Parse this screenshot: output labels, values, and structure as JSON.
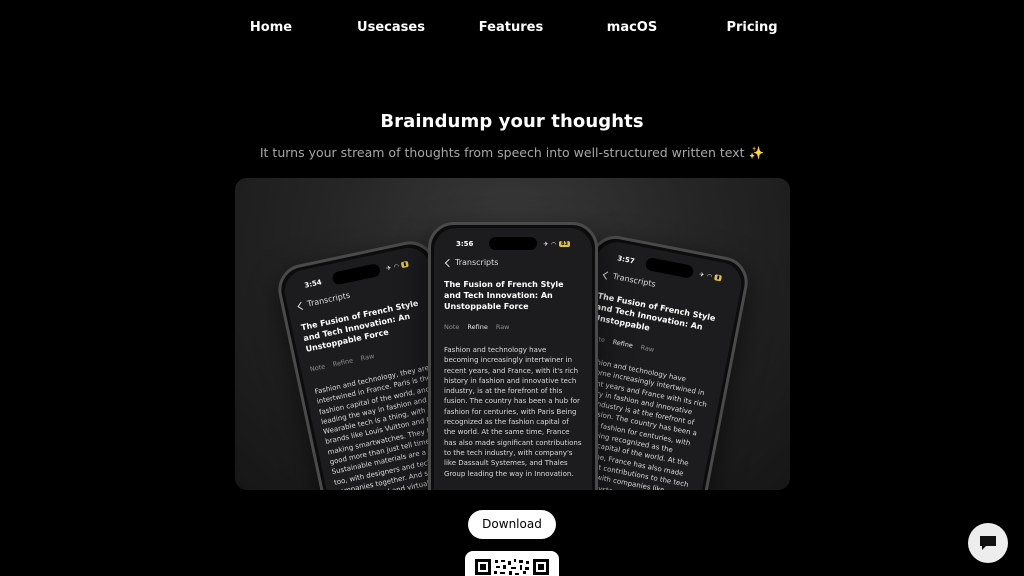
{
  "nav": {
    "items": [
      "Home",
      "Usecases",
      "Features",
      "macOS",
      "Pricing"
    ]
  },
  "hero": {
    "title": "Braindump your thoughts",
    "subtitle": "It turns your stream of thoughts from speech into well-structured written text",
    "sparkle": "✨"
  },
  "phones": {
    "left": {
      "time": "3:54",
      "back_label": "Transcripts",
      "title": "The Fusion of French Style and Tech Innovation: An Unstoppable Force",
      "modes": [
        "Note",
        "Refine",
        "Raw"
      ],
      "body": "Fashion and technology, they are intertwined in France. Paris is the fashion capital of the world, and is leading the way in fashion and Wearable tech is a thing, with brands like Louis Vuitton and Chanel making smartwatches. They look good more than just tell time. Sustainable materials are a trend too, with designers and tech companies together. And shopping? It's augmented and virtual reality. France is a leader in fashion tech."
    },
    "center": {
      "time": "3:56",
      "battery": "83",
      "back_label": "Transcripts",
      "title": "The Fusion of French Style and Tech Innovation: An Unstoppable Force",
      "modes": [
        "Note",
        "Refine",
        "Raw"
      ],
      "body": "Fashion and technology have becoming increasingly intertwiner in recent years, and France, with it's rich history in fashion and innovative tech industry, is at the forefront of this fusion. The country has been a hub for fashion for centuries, with Paris Being recognized as the fashion capital of the world. At the same time, France has also made significant contributions to the tech industry, with company's like Dassault Systemes, and Thales Group leading the way in Innovation."
    },
    "right": {
      "time": "3:57",
      "back_label": "Transcripts",
      "title": "The Fusion of French Style and Tech Innovation: An Unstoppable",
      "modes": [
        "Note",
        "Refine",
        "Raw"
      ],
      "body": "Fashion and technology have become increasingly intertwined in recent years and France with its rich history in fashion and innovative tech industry is at the forefront of this fusion. The country has been a hub for fashion for centuries, with Paris being recognized as the fashion capital of the world. At the same time, France has also made significant contributions to the tech industry, with companies like Dassault Systemes and Thales group leading the way"
    }
  },
  "download": {
    "label": "Download"
  },
  "icons": {
    "chat": "chat-bubble-icon",
    "qr": "qr-code-icon"
  },
  "colors": {
    "background": "#000000",
    "accent_battery": "#e2c43b"
  }
}
